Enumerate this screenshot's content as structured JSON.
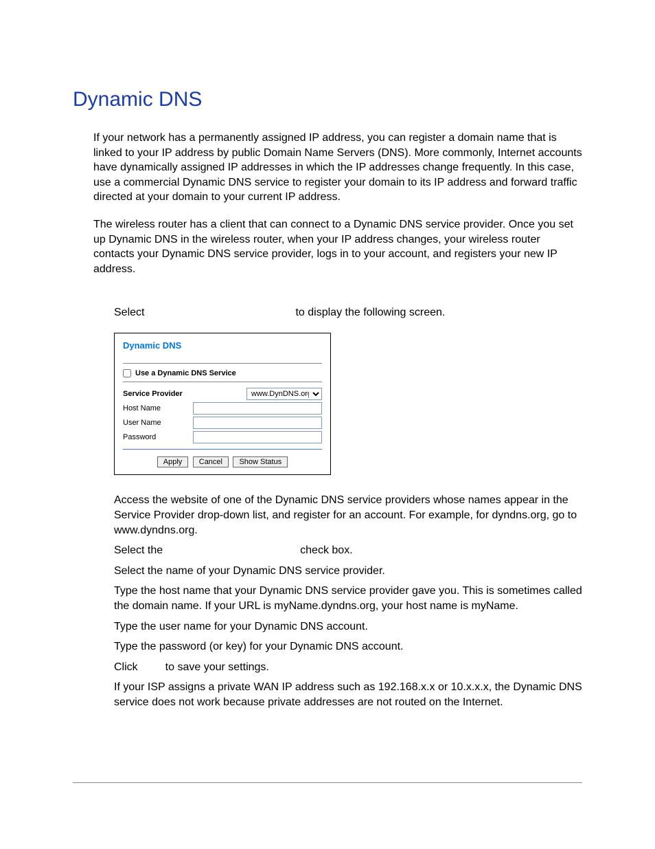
{
  "title": "Dynamic DNS",
  "para1": "If your network has a permanently assigned IP address, you can register a domain name that is linked to your IP address by public Domain Name Servers (DNS). More commonly, Internet accounts have dynamically assigned IP addresses in which the IP addresses change frequently. In this case, use a commercial Dynamic DNS service to register your domain to its IP address and forward traffic directed at your domain to your current IP address.",
  "para2": "The wireless router has a client that can connect to a Dynamic DNS service provider. Once you set up Dynamic DNS in the wireless router, when your IP address changes, your wireless router contacts your Dynamic DNS service provider, logs in to your account, and registers your new IP address.",
  "select_prefix": "Select",
  "select_suffix": "to display the following screen.",
  "panel": {
    "title": "Dynamic DNS",
    "use_label": "Use a Dynamic DNS Service",
    "provider_label": "Service Provider",
    "provider_value": "www.DynDNS.org",
    "host_label": "Host Name",
    "host_value": "",
    "user_label": "User Name",
    "user_value": "",
    "pass_label": "Password",
    "pass_value": "",
    "apply": "Apply",
    "cancel": "Cancel",
    "show_status": "Show Status"
  },
  "steps": {
    "s1": "Access the website of one of the Dynamic DNS service providers whose names appear in the Service Provider drop-down list, and register for an account. For example, for dyndns.org, go to www.dyndns.org.",
    "s2a": "Select the",
    "s2b": "check box.",
    "s3": "Select the name of your Dynamic DNS service provider.",
    "s4": "Type the host name that your Dynamic DNS service provider gave you. This is sometimes called the domain name. If your URL is myName.dyndns.org, your host name is myName.",
    "s5": "Type the user name for your Dynamic DNS account.",
    "s6": "Type the password (or key) for your Dynamic DNS account.",
    "s7a": "Click",
    "s7b": "to save your settings.",
    "s8": "If your ISP assigns a private WAN IP address such as 192.168.x.x or 10.x.x.x, the Dynamic DNS service does not work because private addresses are not routed on the Internet."
  }
}
